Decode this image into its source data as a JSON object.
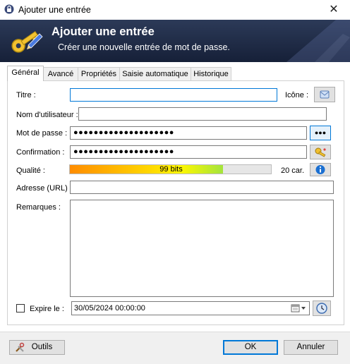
{
  "window": {
    "title": "Ajouter une entrée",
    "close_symbol": "✕"
  },
  "banner": {
    "title": "Ajouter une entrée",
    "subtitle": "Créer une nouvelle entrée de mot de passe."
  },
  "tabs": [
    {
      "label": "Général",
      "active": true
    },
    {
      "label": "Avancé",
      "active": false
    },
    {
      "label": "Propriétés",
      "active": false
    },
    {
      "label": "Saisie automatique",
      "active": false
    },
    {
      "label": "Historique",
      "active": false
    }
  ],
  "form": {
    "title_label": "Titre :",
    "title_value": "",
    "icon_label": "Icône :",
    "username_label": "Nom d'utilisateur :",
    "username_value": "",
    "password_label": "Mot de passe :",
    "password_value": "●●●●●●●●●●●●●●●●●●●●",
    "show_password_label": "●●●",
    "confirm_label": "Confirmation :",
    "confirm_value": "●●●●●●●●●●●●●●●●●●●●",
    "quality_label": "Qualité :",
    "quality_text": "99 bits",
    "quality_fraction": 0.76,
    "char_count": "20 car.",
    "url_label": "Adresse (URL) :",
    "url_value": "",
    "notes_label": "Remarques :",
    "notes_value": "",
    "expires_label": "Expire le :",
    "expires_checked": false,
    "expires_value": "30/05/2024 00:00:00"
  },
  "footer": {
    "tools_label": "Outils",
    "ok_label": "OK",
    "cancel_label": "Annuler"
  },
  "colors": {
    "banner_bg": "#1e2a44",
    "accent": "#0078d7",
    "info_button": "#1a6fd1"
  }
}
